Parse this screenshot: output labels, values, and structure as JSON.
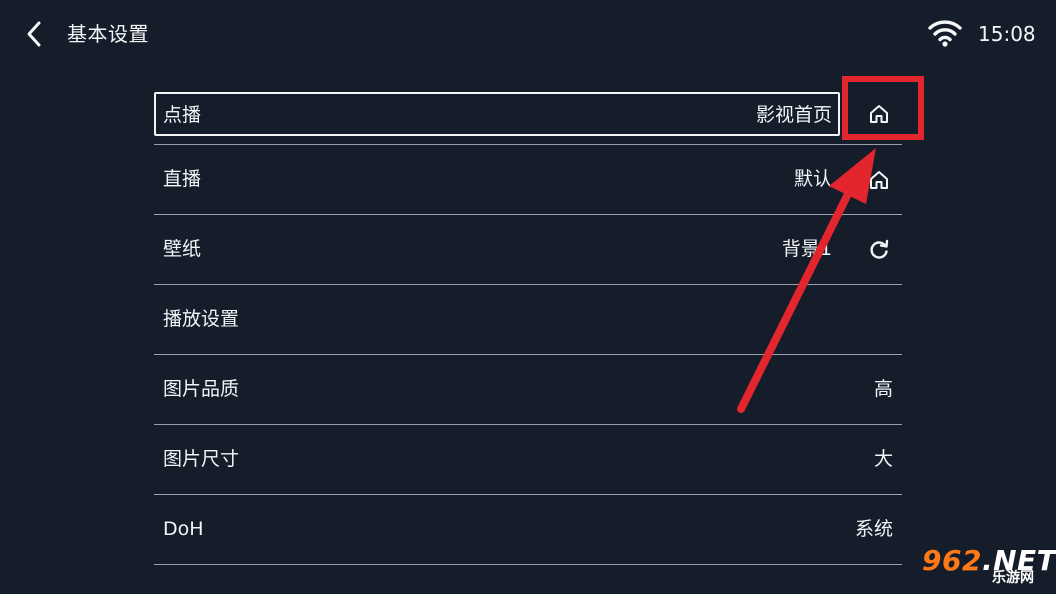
{
  "header": {
    "title": "基本设置",
    "time": "15:08"
  },
  "settings": [
    {
      "label": "点播",
      "value": "影视首页",
      "action_icon": "home-icon"
    },
    {
      "label": "直播",
      "value": "默认",
      "action_icon": "home-icon"
    },
    {
      "label": "壁纸",
      "value": "背景1",
      "action_icon": "refresh-icon"
    },
    {
      "label": "播放设置",
      "value": ""
    },
    {
      "label": "图片品质",
      "value": "高"
    },
    {
      "label": "图片尺寸",
      "value": "大"
    },
    {
      "label": "DoH",
      "value": "系统"
    }
  ],
  "colors": {
    "background": "#151c2a",
    "text": "#f2f4f7",
    "divider": "#9aa1ac",
    "annotation": "#e3262e",
    "watermark_accent": "#ff7a16"
  },
  "watermark": {
    "brand_digits": "962",
    "brand_suffix": ".NET",
    "site_name": "乐游网"
  }
}
